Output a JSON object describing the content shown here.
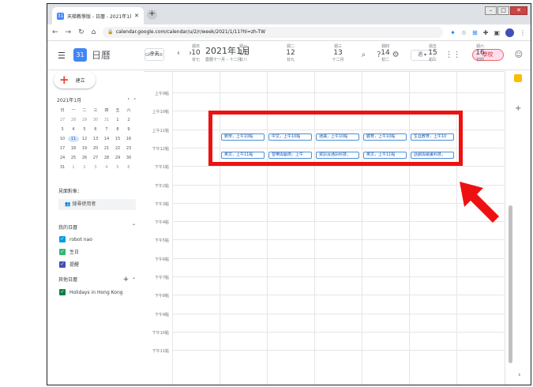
{
  "browser": {
    "tab_title": "天梯教學版 - 日曆 - 2021年1月 -",
    "tab_close": "✕",
    "new_tab": "+",
    "url": "calendar.google.com/calendar/u/2/r/week/2021/1/11?hl=zh-TW"
  },
  "header": {
    "app_title": "日曆",
    "today_label": "今天",
    "prev": "‹",
    "next": "›",
    "month_title": "2021年1月",
    "month_subtitle": "農曆十一月 – 十二月",
    "view_label": "週 ▾",
    "account_label": "學校"
  },
  "sidebar": {
    "create_label": "建立",
    "minical": {
      "title": "2021年1月",
      "weekdays": [
        "日",
        "一",
        "二",
        "三",
        "四",
        "五",
        "六"
      ],
      "rows": [
        [
          "27",
          "28",
          "29",
          "30",
          "31",
          "1",
          "2"
        ],
        [
          "3",
          "4",
          "5",
          "6",
          "7",
          "8",
          "9"
        ],
        [
          "10",
          "11",
          "12",
          "13",
          "14",
          "15",
          "16"
        ],
        [
          "17",
          "18",
          "19",
          "20",
          "21",
          "22",
          "23"
        ],
        [
          "24",
          "25",
          "26",
          "27",
          "28",
          "29",
          "30"
        ],
        [
          "31",
          "1",
          "2",
          "3",
          "4",
          "5",
          "6"
        ]
      ],
      "today": "11"
    },
    "meet_title": "見面對象：",
    "search_people": "搜尋使用者",
    "my_calendars_title": "我的日曆",
    "my_calendars": [
      {
        "name": "robot nao",
        "color": "#039be5"
      },
      {
        "name": "生日",
        "color": "#33b679"
      },
      {
        "name": "提醒",
        "color": "#3f51b5"
      }
    ],
    "other_calendars_title": "其他日曆",
    "other_calendars": [
      {
        "name": "Holidays in Hong Kong",
        "color": "#0b8043"
      }
    ]
  },
  "week": {
    "timezone": "GMT+08",
    "days": [
      {
        "dow": "週日",
        "num": "10",
        "lunar": "廿七"
      },
      {
        "dow": "週一",
        "num": "11",
        "lunar": "廿八"
      },
      {
        "dow": "週二",
        "num": "12",
        "lunar": "廿九"
      },
      {
        "dow": "週三",
        "num": "13",
        "lunar": "十二月"
      },
      {
        "dow": "週四",
        "num": "14",
        "lunar": "初二"
      },
      {
        "dow": "週五",
        "num": "15",
        "lunar": "初三"
      },
      {
        "dow": "週六",
        "num": "16",
        "lunar": "初四"
      }
    ],
    "hours": [
      "上午9點",
      "上午10點",
      "上午11點",
      "下午12點",
      "下午1點",
      "下午2點",
      "下午3點",
      "下午4點",
      "下午5點",
      "下午6點",
      "下午7點",
      "下午8點",
      "下午9點",
      "下午10點",
      "下午11點"
    ],
    "events_row1": [
      "數學，上午10點",
      "中文，上午10點",
      "通識，上午10點",
      "體育，上午10點",
      "生涯教育，上午10"
    ],
    "events_row2": [
      "英文，上午11點",
      "音樂與藝術，上午",
      "資訊及通訊科技，",
      "英文，上午11點",
      "話劇與繪畫科技，"
    ]
  },
  "colors": {
    "accent": "#4285f4",
    "event_border": "#4a90d9",
    "highlight": "#ee1111"
  }
}
